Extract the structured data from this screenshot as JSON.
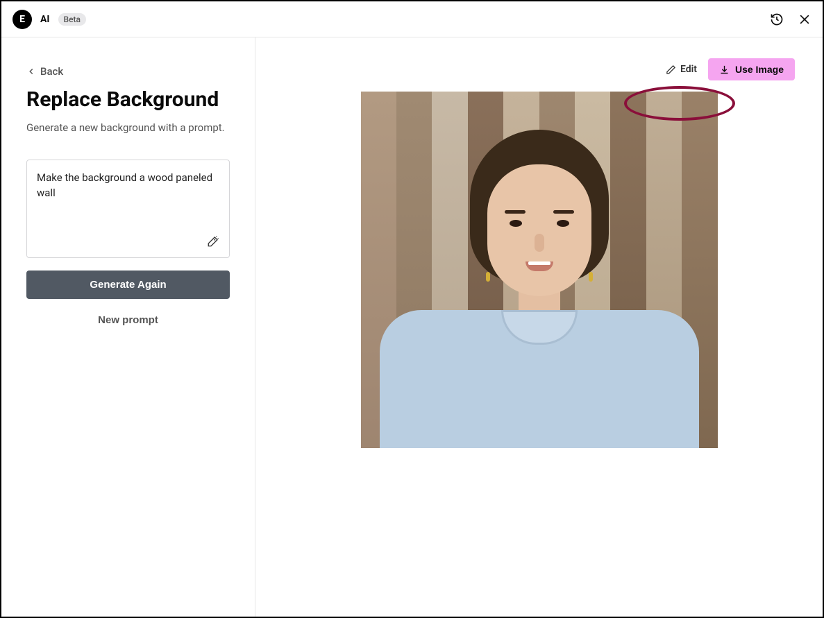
{
  "header": {
    "app_name": "AI",
    "badge": "Beta"
  },
  "sidebar": {
    "back_label": "Back",
    "title": "Replace Background",
    "subtitle": "Generate a new background with a prompt.",
    "prompt_value": "Make the background a wood paneled wall",
    "generate_button": "Generate Again",
    "new_prompt_button": "New prompt"
  },
  "toolbar": {
    "edit_label": "Edit",
    "use_image_label": "Use Image"
  },
  "icons": {
    "logo": "E",
    "history": "history-icon",
    "close": "close-icon",
    "chevron_left": "chevron-left-icon",
    "wand": "wand-icon",
    "pencil": "pencil-icon",
    "download": "download-icon"
  }
}
